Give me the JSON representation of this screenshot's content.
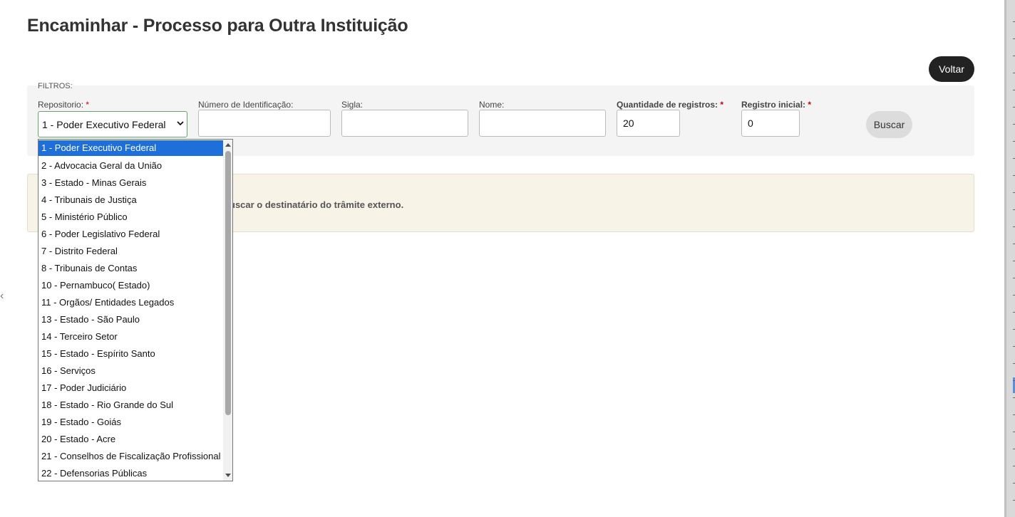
{
  "title": "Encaminhar - Processo para Outra Instituição",
  "buttons": {
    "voltar": "Voltar",
    "buscar": "Buscar"
  },
  "filters": {
    "section_label": "FILTROS:",
    "repositorio": {
      "label": "Repositorio:",
      "required": "*",
      "value": "1 - Poder Executivo Federal"
    },
    "numero": {
      "label": "Número de Identificação:",
      "value": ""
    },
    "sigla": {
      "label": "Sigla:",
      "value": ""
    },
    "nome": {
      "label": "Nome:",
      "value": ""
    },
    "quantidade": {
      "label": "Quantidade de registros:",
      "required": "*",
      "value": "20"
    },
    "registro": {
      "label": "Registro inicial:",
      "required": "*",
      "value": "0"
    }
  },
  "notice": {
    "text": "uscar o destinatário do trâmite externo."
  },
  "dropdown_options": [
    "1 - Poder Executivo Federal",
    "2 - Advocacia Geral da União",
    "3 - Estado - Minas Gerais",
    "4 - Tribunais de Justiça",
    "5 - Ministério Público",
    "6 - Poder Legislativo Federal",
    "7 - Distrito Federal",
    "8 - Tribunais de Contas",
    "10 - Pernambuco( Estado)",
    "11 - Orgãos/ Entidades Legados",
    "13 - Estado - São Paulo",
    "14 - Terceiro Setor",
    "15 - Estado - Espírito Santo",
    "16 - Serviços",
    "17 - Poder Judiciário",
    "18 - Estado - Rio Grande do Sul",
    "19 - Estado - Goiás",
    "20 - Estado - Acre",
    "21 - Conselhos de Fiscalização Profissional",
    "22 - Defensorias Públicas"
  ],
  "selected_option_index": 0,
  "colors": {
    "selected": "#1e6fd9",
    "dark_button": "#222222",
    "notice_bg": "#f7f3e6"
  }
}
